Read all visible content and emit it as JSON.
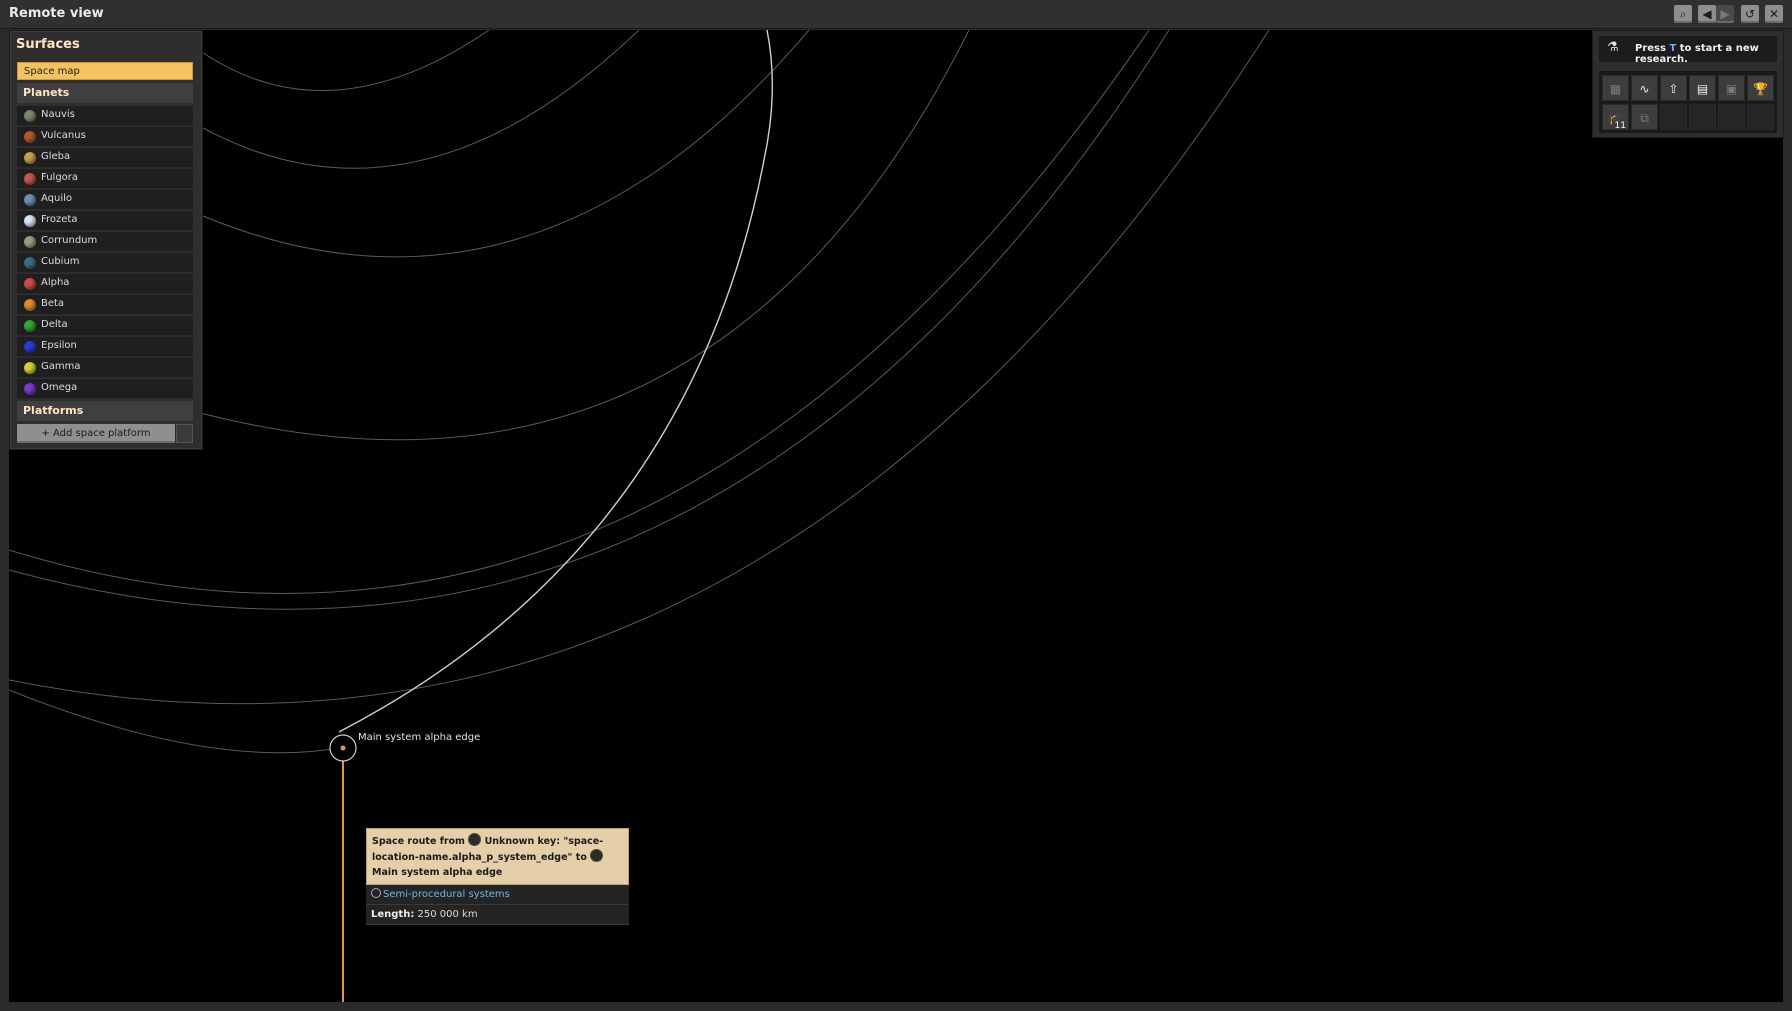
{
  "window": {
    "title": "Remote view",
    "buttons": [
      "search-icon",
      "back-icon",
      "forward-icon",
      "reset-icon",
      "close-icon"
    ],
    "button_glyphs": [
      "⌕",
      "◀",
      "▶",
      "↺",
      "✕"
    ]
  },
  "surfaces": {
    "title": "Surfaces",
    "space_map_label": "Space map",
    "planets_header": "Planets",
    "planets": [
      {
        "name": "Nauvis",
        "color": "#7a8a6a"
      },
      {
        "name": "Vulcanus",
        "color": "#b4582a"
      },
      {
        "name": "Gleba",
        "color": "#c6a34a"
      },
      {
        "name": "Fulgora",
        "color": "#c65454"
      },
      {
        "name": "Aquilo",
        "color": "#6c8fb0"
      },
      {
        "name": "Frozeta",
        "color": "#d8e6f2"
      },
      {
        "name": "Corrundum",
        "color": "#9aa07a"
      },
      {
        "name": "Cubium",
        "color": "#3c6e86"
      },
      {
        "name": "Alpha",
        "color": "#d04a4a"
      },
      {
        "name": "Beta",
        "color": "#e08a2c"
      },
      {
        "name": "Delta",
        "color": "#2ea82e"
      },
      {
        "name": "Epsilon",
        "color": "#2c3cd8"
      },
      {
        "name": "Gamma",
        "color": "#d6d02a"
      },
      {
        "name": "Omega",
        "color": "#7a3ad0"
      }
    ],
    "platforms_header": "Platforms",
    "add_platform_label": "+ Add space platform"
  },
  "research": {
    "prompt_prefix": "Press ",
    "prompt_key": "T",
    "prompt_suffix": " to start a new research.",
    "buttons": [
      {
        "icon": "factory-icon",
        "glyph": "▦"
      },
      {
        "icon": "production-stats-icon",
        "glyph": "∿"
      },
      {
        "icon": "logistics-icon",
        "glyph": "⇧"
      },
      {
        "icon": "factoriopedia-icon",
        "glyph": "▤"
      },
      {
        "icon": "train-icon",
        "glyph": "▣"
      },
      {
        "icon": "achievements-icon",
        "glyph": "🏆"
      },
      {
        "icon": "technology-icon",
        "glyph": "🎓"
      },
      {
        "icon": "blueprint-icon",
        "glyph": "⧉"
      }
    ],
    "tech_badge": "11"
  },
  "map": {
    "location_label": "Main system alpha edge",
    "route_color": "#e09a3a"
  },
  "tooltip": {
    "header_prefix": "Space route from ",
    "from_name": "Unknown key: \"space-location-name.alpha_p_system_edge\"",
    "header_to": " to ",
    "to_name": "Main system alpha edge",
    "mod_name": "Semi-procedural systems",
    "length_label": "Length:",
    "length_value": " 250 000 km"
  }
}
